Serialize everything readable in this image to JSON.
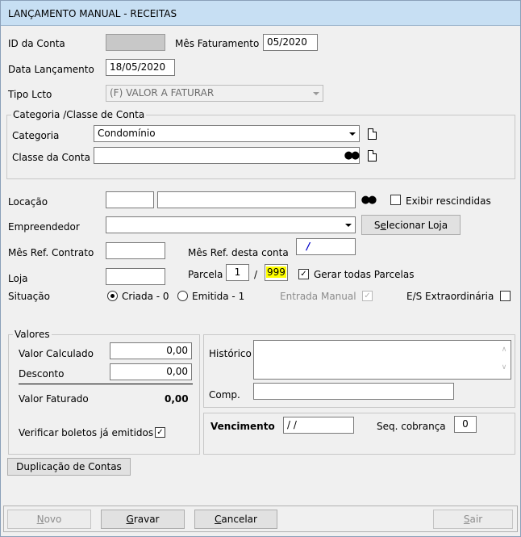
{
  "window": {
    "title": "LANÇAMENTO MANUAL - RECEITAS"
  },
  "fields": {
    "id_conta_label": "ID da Conta",
    "id_conta_value": "",
    "mes_faturamento_label": "Mês Faturamento",
    "mes_faturamento_value": "05/2020",
    "data_lancamento_label": "Data Lançamento",
    "data_lancamento_value": "18/05/2020",
    "tipo_lcto_label": "Tipo Lcto",
    "tipo_lcto_value": "(F) VALOR A FATURAR"
  },
  "categoria_group": {
    "legend": "Categoria /Classe de Conta",
    "categoria_label": "Categoria",
    "categoria_value": "Condomínio",
    "classe_label": "Classe da Conta",
    "classe_value": ""
  },
  "main": {
    "locacao_label": "Locação",
    "locacao_code": "",
    "locacao_desc": "",
    "exibir_rescindidas_label": "Exibir rescindidas",
    "exibir_rescindidas_checked": false,
    "empreendedor_label": "Empreendedor",
    "empreendedor_value": "",
    "selecionar_loja_pre": "S",
    "selecionar_loja_u": "e",
    "selecionar_loja_post": "lecionar Loja",
    "mes_ref_contrato_label": "Mês Ref. Contrato",
    "mes_ref_contrato_value": "",
    "mes_ref_conta_label": "Mês Ref. desta conta",
    "mes_ref_conta_value": "/",
    "loja_label": "Loja",
    "loja_value": "",
    "parcela_label": "Parcela",
    "parcela_value": "1",
    "parcela_sep": "/",
    "parcela_total": "999",
    "gerar_parcelas_label": "Gerar todas Parcelas",
    "gerar_parcelas_checked": true,
    "situacao_label": "Situação",
    "criada_label": "Criada - 0",
    "emitida_label": "Emitida - 1",
    "situacao_selected": "Criada - 0",
    "entrada_manual_label": "Entrada Manual",
    "entrada_manual_checked": true,
    "es_extra_label": "E/S Extraordinária",
    "es_extra_checked": false
  },
  "valores": {
    "legend": "Valores",
    "valor_calculado_label": "Valor Calculado",
    "valor_calculado_value": "0,00",
    "desconto_label": "Desconto",
    "desconto_value": "0,00",
    "valor_faturado_label": "Valor Faturado",
    "valor_faturado_value": "0,00",
    "verificar_boletos_label": "Verificar boletos já emitidos",
    "verificar_boletos_checked": true
  },
  "historico": {
    "historico_label": "Histórico",
    "historico_value": "",
    "comp_label": "Comp.",
    "comp_value": ""
  },
  "vencimento": {
    "label": "Vencimento",
    "value": "/ /",
    "seq_label": "Seq. cobrança",
    "seq_value": "0"
  },
  "duplicacao_button": "Duplicação de Contas",
  "footer": {
    "novo_u": "N",
    "novo_post": "ovo",
    "gravar_u": "G",
    "gravar_post": "ravar",
    "cancelar_u": "C",
    "cancelar_post": "ancelar",
    "sair_u": "S",
    "sair_post": "air"
  }
}
